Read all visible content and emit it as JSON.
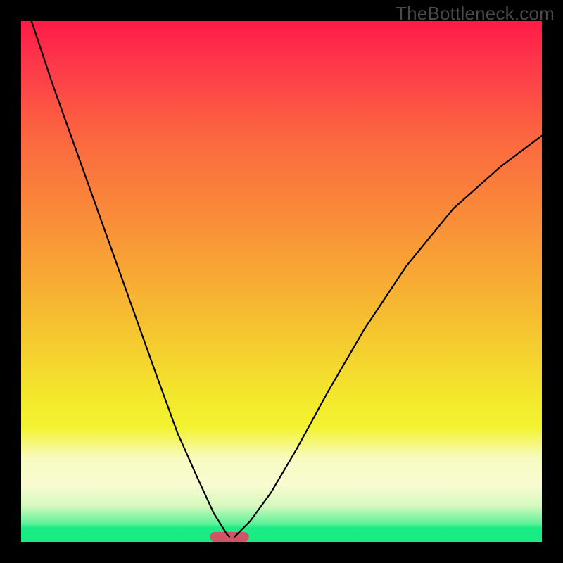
{
  "watermark": "TheBottleneck.com",
  "colors": {
    "frame": "#000000",
    "gradient_top": "#fe1a47",
    "gradient_mid": "#f3e72c",
    "gradient_bottom": "#19eb84",
    "curve_stroke": "#000000",
    "pill_fill": "#cf5468",
    "watermark_text": "#4a4a4a"
  },
  "chart_data": {
    "type": "line",
    "title": "",
    "xlabel": "",
    "ylabel": "",
    "x_range": [
      0,
      1
    ],
    "y_range": [
      0,
      1
    ],
    "notes": "Horizontal axis is an unlabeled normalized parameter (0–1); vertical axis is an unlabeled normalized bottleneck/mismatch metric (0 = green/good at bottom, 1 = red/bad at top). Minimum of the V-curve occurs near x ≈ 0.40. Values are estimated from pixel positions; no numeric labels are shown in the image.",
    "series": [
      {
        "name": "left-branch",
        "x": [
          0.02,
          0.06,
          0.11,
          0.16,
          0.21,
          0.26,
          0.3,
          0.34,
          0.37,
          0.395,
          0.4
        ],
        "y": [
          1.0,
          0.88,
          0.74,
          0.6,
          0.46,
          0.32,
          0.21,
          0.12,
          0.055,
          0.015,
          0.01
        ]
      },
      {
        "name": "right-branch",
        "x": [
          0.41,
          0.44,
          0.48,
          0.53,
          0.59,
          0.66,
          0.74,
          0.83,
          0.92,
          1.0
        ],
        "y": [
          0.01,
          0.04,
          0.095,
          0.18,
          0.29,
          0.41,
          0.53,
          0.64,
          0.72,
          0.78
        ]
      }
    ],
    "marker": {
      "name": "optimal-point-pill",
      "x_center": 0.4,
      "x_width": 0.075,
      "y": 0.0
    },
    "background_gradient_stops": [
      {
        "pos": 0.0,
        "color": "#fe1a47"
      },
      {
        "pos": 0.4,
        "color": "#f99238"
      },
      {
        "pos": 0.72,
        "color": "#f3e72c"
      },
      {
        "pos": 0.89,
        "color": "#f9fbd0"
      },
      {
        "pos": 1.0,
        "color": "#19eb84"
      }
    ]
  }
}
